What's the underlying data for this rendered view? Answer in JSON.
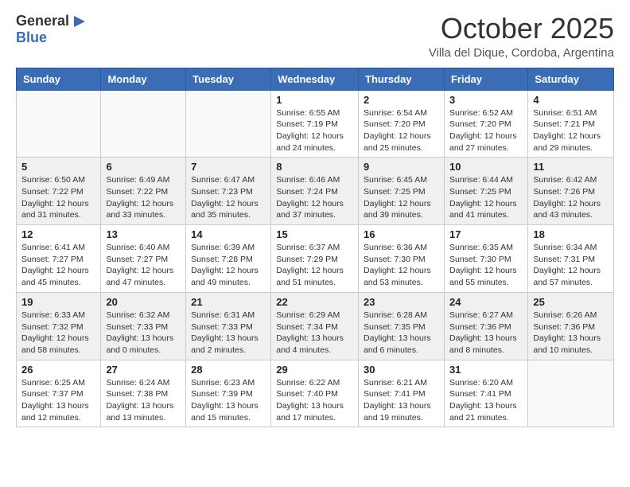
{
  "header": {
    "logo_general": "General",
    "logo_blue": "Blue",
    "title": "October 2025",
    "location": "Villa del Dique, Cordoba, Argentina"
  },
  "days_of_week": [
    "Sunday",
    "Monday",
    "Tuesday",
    "Wednesday",
    "Thursday",
    "Friday",
    "Saturday"
  ],
  "weeks": [
    [
      {
        "day": "",
        "info": ""
      },
      {
        "day": "",
        "info": ""
      },
      {
        "day": "",
        "info": ""
      },
      {
        "day": "1",
        "info": "Sunrise: 6:55 AM\nSunset: 7:19 PM\nDaylight: 12 hours\nand 24 minutes."
      },
      {
        "day": "2",
        "info": "Sunrise: 6:54 AM\nSunset: 7:20 PM\nDaylight: 12 hours\nand 25 minutes."
      },
      {
        "day": "3",
        "info": "Sunrise: 6:52 AM\nSunset: 7:20 PM\nDaylight: 12 hours\nand 27 minutes."
      },
      {
        "day": "4",
        "info": "Sunrise: 6:51 AM\nSunset: 7:21 PM\nDaylight: 12 hours\nand 29 minutes."
      }
    ],
    [
      {
        "day": "5",
        "info": "Sunrise: 6:50 AM\nSunset: 7:22 PM\nDaylight: 12 hours\nand 31 minutes."
      },
      {
        "day": "6",
        "info": "Sunrise: 6:49 AM\nSunset: 7:22 PM\nDaylight: 12 hours\nand 33 minutes."
      },
      {
        "day": "7",
        "info": "Sunrise: 6:47 AM\nSunset: 7:23 PM\nDaylight: 12 hours\nand 35 minutes."
      },
      {
        "day": "8",
        "info": "Sunrise: 6:46 AM\nSunset: 7:24 PM\nDaylight: 12 hours\nand 37 minutes."
      },
      {
        "day": "9",
        "info": "Sunrise: 6:45 AM\nSunset: 7:25 PM\nDaylight: 12 hours\nand 39 minutes."
      },
      {
        "day": "10",
        "info": "Sunrise: 6:44 AM\nSunset: 7:25 PM\nDaylight: 12 hours\nand 41 minutes."
      },
      {
        "day": "11",
        "info": "Sunrise: 6:42 AM\nSunset: 7:26 PM\nDaylight: 12 hours\nand 43 minutes."
      }
    ],
    [
      {
        "day": "12",
        "info": "Sunrise: 6:41 AM\nSunset: 7:27 PM\nDaylight: 12 hours\nand 45 minutes."
      },
      {
        "day": "13",
        "info": "Sunrise: 6:40 AM\nSunset: 7:27 PM\nDaylight: 12 hours\nand 47 minutes."
      },
      {
        "day": "14",
        "info": "Sunrise: 6:39 AM\nSunset: 7:28 PM\nDaylight: 12 hours\nand 49 minutes."
      },
      {
        "day": "15",
        "info": "Sunrise: 6:37 AM\nSunset: 7:29 PM\nDaylight: 12 hours\nand 51 minutes."
      },
      {
        "day": "16",
        "info": "Sunrise: 6:36 AM\nSunset: 7:30 PM\nDaylight: 12 hours\nand 53 minutes."
      },
      {
        "day": "17",
        "info": "Sunrise: 6:35 AM\nSunset: 7:30 PM\nDaylight: 12 hours\nand 55 minutes."
      },
      {
        "day": "18",
        "info": "Sunrise: 6:34 AM\nSunset: 7:31 PM\nDaylight: 12 hours\nand 57 minutes."
      }
    ],
    [
      {
        "day": "19",
        "info": "Sunrise: 6:33 AM\nSunset: 7:32 PM\nDaylight: 12 hours\nand 58 minutes."
      },
      {
        "day": "20",
        "info": "Sunrise: 6:32 AM\nSunset: 7:33 PM\nDaylight: 13 hours\nand 0 minutes."
      },
      {
        "day": "21",
        "info": "Sunrise: 6:31 AM\nSunset: 7:33 PM\nDaylight: 13 hours\nand 2 minutes."
      },
      {
        "day": "22",
        "info": "Sunrise: 6:29 AM\nSunset: 7:34 PM\nDaylight: 13 hours\nand 4 minutes."
      },
      {
        "day": "23",
        "info": "Sunrise: 6:28 AM\nSunset: 7:35 PM\nDaylight: 13 hours\nand 6 minutes."
      },
      {
        "day": "24",
        "info": "Sunrise: 6:27 AM\nSunset: 7:36 PM\nDaylight: 13 hours\nand 8 minutes."
      },
      {
        "day": "25",
        "info": "Sunrise: 6:26 AM\nSunset: 7:36 PM\nDaylight: 13 hours\nand 10 minutes."
      }
    ],
    [
      {
        "day": "26",
        "info": "Sunrise: 6:25 AM\nSunset: 7:37 PM\nDaylight: 13 hours\nand 12 minutes."
      },
      {
        "day": "27",
        "info": "Sunrise: 6:24 AM\nSunset: 7:38 PM\nDaylight: 13 hours\nand 13 minutes."
      },
      {
        "day": "28",
        "info": "Sunrise: 6:23 AM\nSunset: 7:39 PM\nDaylight: 13 hours\nand 15 minutes."
      },
      {
        "day": "29",
        "info": "Sunrise: 6:22 AM\nSunset: 7:40 PM\nDaylight: 13 hours\nand 17 minutes."
      },
      {
        "day": "30",
        "info": "Sunrise: 6:21 AM\nSunset: 7:41 PM\nDaylight: 13 hours\nand 19 minutes."
      },
      {
        "day": "31",
        "info": "Sunrise: 6:20 AM\nSunset: 7:41 PM\nDaylight: 13 hours\nand 21 minutes."
      },
      {
        "day": "",
        "info": ""
      }
    ]
  ]
}
